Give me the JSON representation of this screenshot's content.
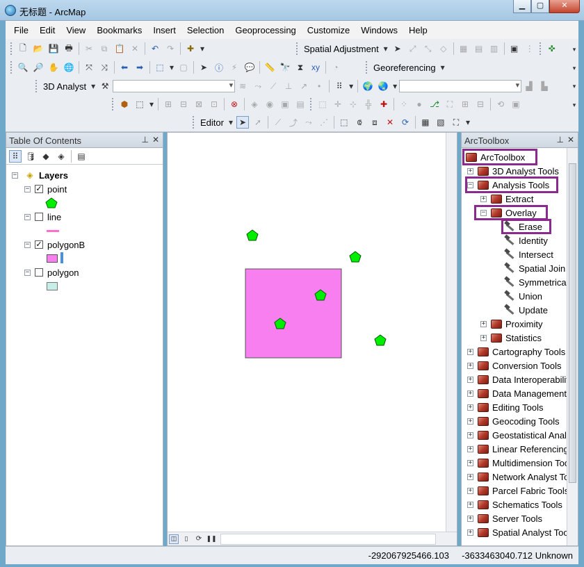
{
  "window": {
    "title": "无标题 - ArcMap",
    "minimize": "▁",
    "maximize": "▢",
    "close": "✕"
  },
  "menu": [
    "File",
    "Edit",
    "View",
    "Bookmarks",
    "Insert",
    "Selection",
    "Geoprocessing",
    "Customize",
    "Windows",
    "Help"
  ],
  "toolbars": {
    "spatial_adjustment": "Spatial Adjustment",
    "georeferencing": "Georeferencing",
    "analyst_3d": "3D Analyst",
    "editor": "Editor"
  },
  "toc": {
    "title": "Table Of Contents",
    "layers_label": "Layers",
    "layers": [
      {
        "name": "point",
        "checked": true
      },
      {
        "name": "line",
        "checked": false
      },
      {
        "name": "polygonB",
        "checked": true
      },
      {
        "name": "polygon",
        "checked": false
      }
    ],
    "symbol_colors": {
      "point": "#00ee00",
      "line": "#ff6fd0",
      "polygonB": "#f77ff0",
      "polygon": "#c8eeea"
    }
  },
  "map": {
    "polygon_color": "#f77ff0",
    "point_color": "#00ee00"
  },
  "toolbox": {
    "title": "ArcToolbox",
    "root": "ArcToolbox",
    "items": [
      {
        "label": "3D Analyst Tools"
      },
      {
        "label": "Analysis Tools"
      },
      {
        "label": "Extract"
      },
      {
        "label": "Overlay"
      },
      {
        "label": "Erase"
      },
      {
        "label": "Identity"
      },
      {
        "label": "Intersect"
      },
      {
        "label": "Spatial Join"
      },
      {
        "label": "Symmetrical"
      },
      {
        "label": "Union"
      },
      {
        "label": "Update"
      },
      {
        "label": "Proximity"
      },
      {
        "label": "Statistics"
      },
      {
        "label": "Cartography Tools"
      },
      {
        "label": "Conversion Tools"
      },
      {
        "label": "Data Interoperability"
      },
      {
        "label": "Data Management"
      },
      {
        "label": "Editing Tools"
      },
      {
        "label": "Geocoding Tools"
      },
      {
        "label": "Geostatistical Analyst"
      },
      {
        "label": "Linear Referencing"
      },
      {
        "label": "Multidimension Tools"
      },
      {
        "label": "Network Analyst Tools"
      },
      {
        "label": "Parcel Fabric Tools"
      },
      {
        "label": "Schematics Tools"
      },
      {
        "label": "Server Tools"
      },
      {
        "label": "Spatial Analyst Tools"
      }
    ],
    "highlight_color": "#8a2a8e"
  },
  "status": {
    "x": "-292067925466.103",
    "y": "-3633463040.712",
    "units": "Unknown"
  }
}
